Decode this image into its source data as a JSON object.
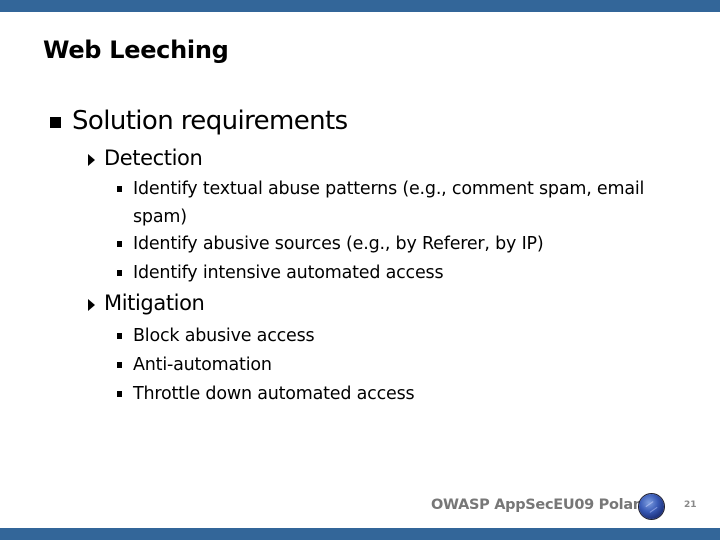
{
  "slide": {
    "title": "Web Leeching",
    "bullets": {
      "level1": "Solution requirements",
      "detection": {
        "label": "Detection",
        "items": [
          "Identify textual abuse patterns (e.g., comment spam, email spam)",
          "Identify abusive sources (e.g., by Referer, by IP)",
          "Identify intensive automated access"
        ]
      },
      "mitigation": {
        "label": "Mitigation",
        "items": [
          "Block abusive access",
          "Anti-automation",
          "Throttle down automated access"
        ]
      }
    }
  },
  "footer": {
    "text": "OWASP AppSecEU09 Poland",
    "logo_icon": "owasp-globe-icon",
    "page_number": "21"
  },
  "colors": {
    "bar": "#336699",
    "footer_text": "#777777"
  }
}
